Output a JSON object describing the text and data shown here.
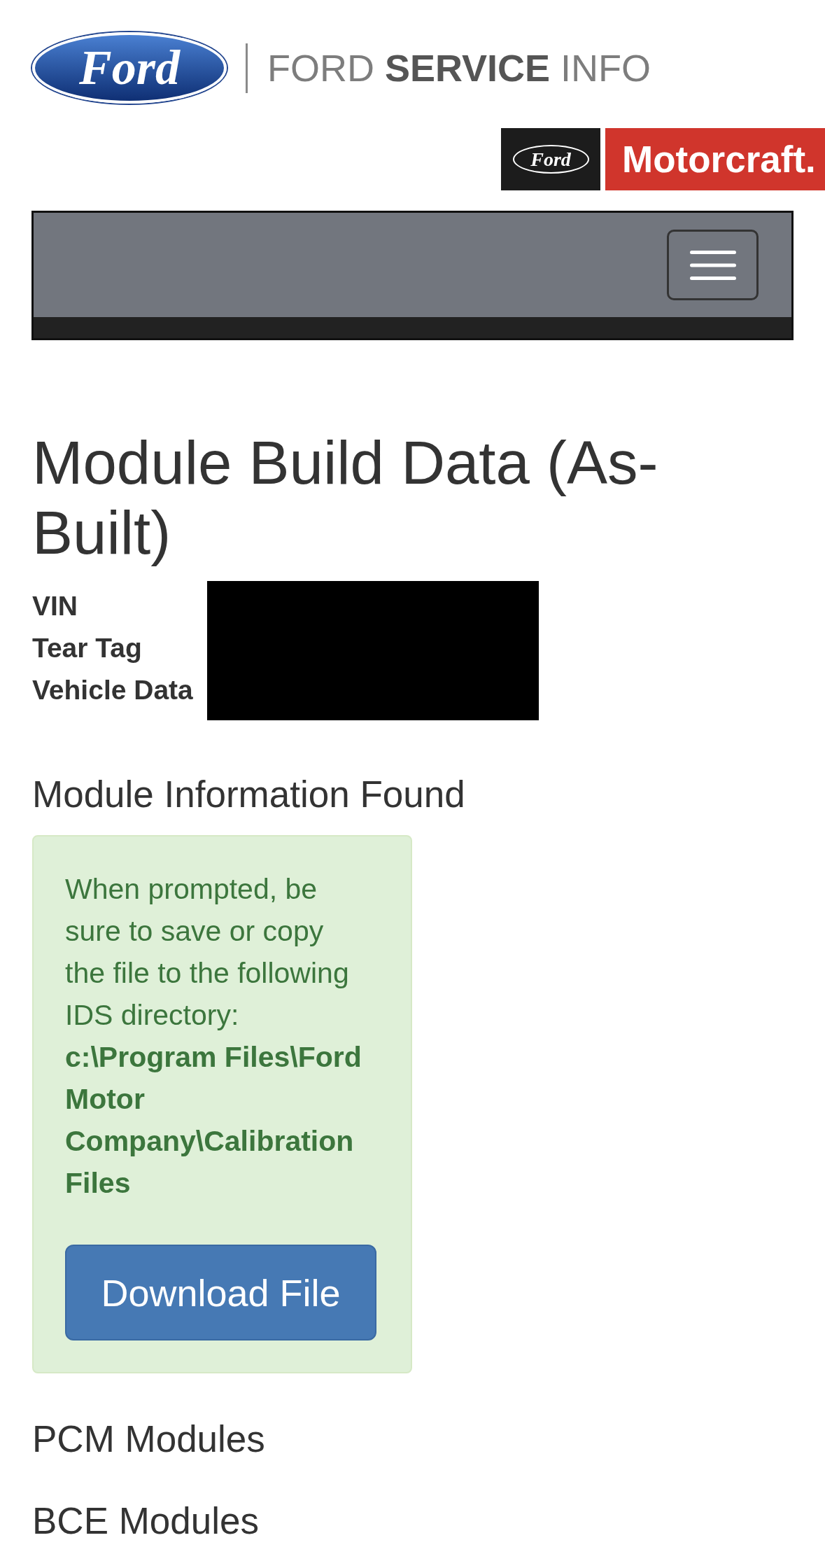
{
  "header": {
    "logo": {
      "emblem_text": "Ford",
      "wordmark": "FORD **SERVICE** INFO"
    },
    "partner_badge": {
      "emblem_text": "Ford",
      "name": "Motorcraft."
    }
  },
  "page_title": "Module Build Data (As-Built)",
  "vehicle_info": [
    {
      "label": "VIN"
    },
    {
      "label": "Tear Tag"
    },
    {
      "label": "Vehicle Data"
    }
  ],
  "module_info": {
    "heading": "Module Information Found",
    "alert": {
      "message": "When prompted, be sure to save or copy the file to the following IDS directory: **c:\\Program Files\\Ford Motor Company\\Calibration Files**",
      "button": "Download File"
    }
  },
  "module_groups": [
    {
      "heading": "PCM Modules"
    },
    {
      "heading": "BCE Modules"
    }
  ]
}
